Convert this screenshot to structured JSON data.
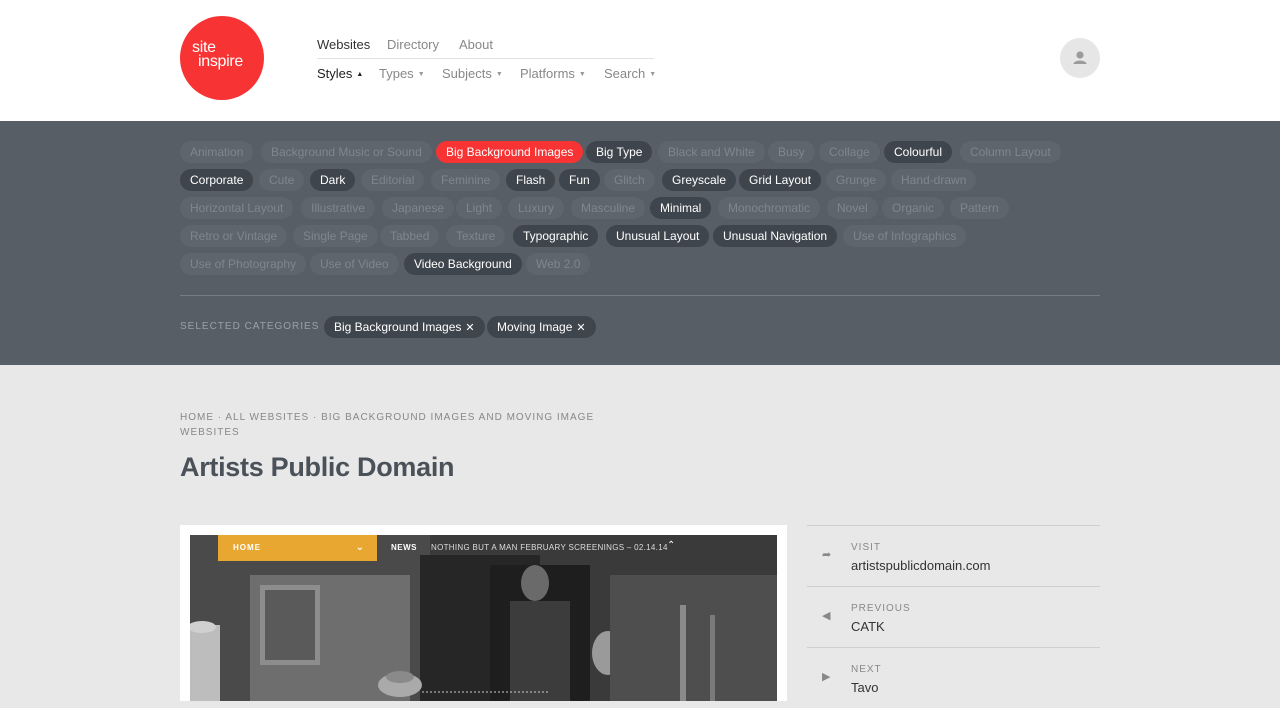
{
  "logo": {
    "line1": "site",
    "line2": "inspire"
  },
  "nav": {
    "primary": [
      "Websites",
      "Directory",
      "About"
    ],
    "secondary": [
      {
        "label": "Styles",
        "caret": "▲"
      },
      {
        "label": "Types",
        "caret": "▼"
      },
      {
        "label": "Subjects",
        "caret": "▼"
      },
      {
        "label": "Platforms",
        "caret": "▼"
      },
      {
        "label": "Search",
        "caret": "▼"
      }
    ]
  },
  "styles_tags": [
    "Animation",
    "Background Music or Sound",
    "Big Background Images",
    "Big Type",
    "Black and White",
    "Busy",
    "Collage",
    "Colourful",
    "Column Layout",
    "Corporate",
    "Cute",
    "Dark",
    "Editorial",
    "Feminine",
    "Flash",
    "Fun",
    "Glitch",
    "Greyscale",
    "Grid Layout",
    "Grunge",
    "Hand-drawn",
    "Horizontal Layout",
    "Illustrative",
    "Japanese",
    "Light",
    "Luxury",
    "Masculine",
    "Minimal",
    "Monochromatic",
    "Novel",
    "Organic",
    "Pattern",
    "Retro or Vintage",
    "Single Page",
    "Tabbed",
    "Texture",
    "Typographic",
    "Unusual Layout",
    "Unusual Navigation",
    "Use of Infographics",
    "Use of Photography",
    "Use of Video",
    "Video Background",
    "Web 2.0"
  ],
  "selected": {
    "label": "SELECTED CATEGORIES",
    "items": [
      "Big Background Images",
      "Moving Image"
    ],
    "remove_glyph": "✕"
  },
  "breadcrumb": "HOME · ALL WEBSITES · BIG BACKGROUND IMAGES AND MOVING IMAGE WEBSITES",
  "title": "Artists Public Domain",
  "screenshot": {
    "home": "HOME",
    "chevron": "⌄",
    "news": "NEWS",
    "ticker": "NOTHING BUT A MAN FEBRUARY SCREENINGS  –  02.14.14",
    "up": "⌃"
  },
  "side": {
    "visit": {
      "label": "VISIT",
      "value": "artistspublicdomain.com",
      "icon": "➦"
    },
    "previous": {
      "label": "PREVIOUS",
      "value": "CATK",
      "icon": "◀"
    },
    "next": {
      "label": "NEXT",
      "value": "Tavo",
      "icon": "▶"
    }
  },
  "colors": {
    "accent": "#f73334",
    "panel": "#575e66",
    "tag_selected": "#3f454c",
    "content_bg": "#e8e8e8",
    "mini_home": "#e8a731"
  }
}
